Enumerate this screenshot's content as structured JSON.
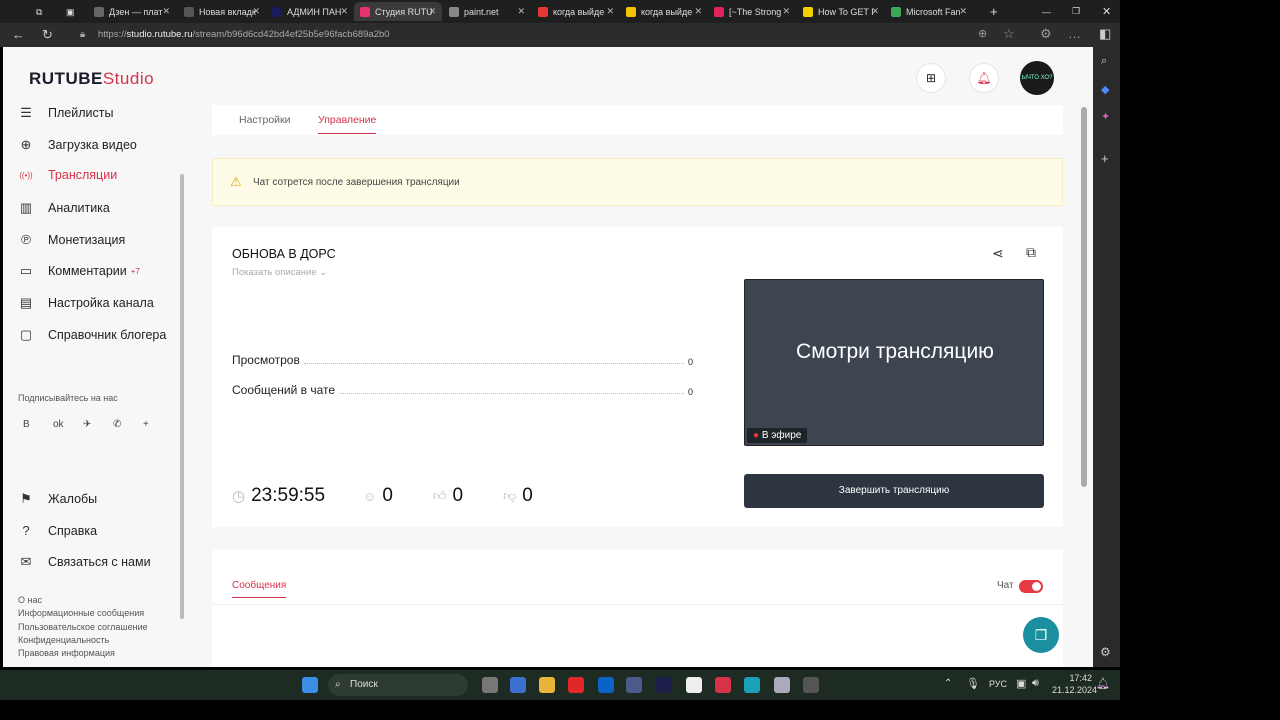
{
  "browser": {
    "tabs": [
      {
        "label": "Дзен — плат",
        "color": "#666"
      },
      {
        "label": "Новая вкладк",
        "color": "#555"
      },
      {
        "label": "АДМИН ПАН",
        "color": "#1a1a5e"
      },
      {
        "label": "Студия RUTU",
        "color": "#e5336b",
        "active": true
      },
      {
        "label": "paint.net",
        "color": "#888"
      },
      {
        "label": "когда выйде",
        "color": "#e53935"
      },
      {
        "label": "когда выйде",
        "color": "#f5c400"
      },
      {
        "label": "[~The Strong",
        "color": "#e0245e"
      },
      {
        "label": "How To GET I",
        "color": "#f5d000"
      },
      {
        "label": "Microsoft Fan",
        "color": "#3aa757"
      }
    ],
    "url_prefix": "https://",
    "url_host": "studio.rutube.ru",
    "url_path": "/stream/b96d6cd42bd4ef25b5e96facb689a2b0"
  },
  "header": {
    "logo_main": "RUTUBE",
    "logo_studio": "Studio",
    "avatar_text": "ЫЧТО ХО?"
  },
  "sidebar": {
    "items": [
      {
        "label": "Плейлисты",
        "icon": "☰"
      },
      {
        "label": "Загрузка видео",
        "icon": "⊕"
      },
      {
        "label": "Трансляции",
        "icon": "((•))"
      },
      {
        "label": "Аналитика",
        "icon": "▥"
      },
      {
        "label": "Монетизация",
        "icon": "℗"
      },
      {
        "label": "Комментарии",
        "icon": "▭",
        "badge": "+7"
      },
      {
        "label": "Настройка канала",
        "icon": "▤"
      },
      {
        "label": "Справочник блогера",
        "icon": "▢"
      }
    ],
    "follow_label": "Подписывайтесь на нас",
    "socials": [
      "vk",
      "ok",
      "tg",
      "viber",
      "+"
    ],
    "bottom_items": [
      {
        "label": "Жалобы",
        "icon": "⚑"
      },
      {
        "label": "Справка",
        "icon": "?"
      },
      {
        "label": "Связаться с нами",
        "icon": "✉"
      }
    ],
    "footer_links": [
      "О нас",
      "Информационные сообщения",
      "Пользовательское соглашение",
      "Конфиденциальность",
      "Правовая информация"
    ]
  },
  "main": {
    "tabs": [
      {
        "label": "Настройки"
      },
      {
        "label": "Управление",
        "active": true
      }
    ],
    "warning": "Чат сотрется после завершения трансляции",
    "stream": {
      "title": "ОБНОВА В ДОРС",
      "show_description": "Показать описание",
      "stats": [
        {
          "label": "Просмотров",
          "value": "0"
        },
        {
          "label": "Сообщений в чате",
          "value": "0"
        }
      ],
      "timer": "23:59:55",
      "viewers": "0",
      "likes": "0",
      "dislikes": "0",
      "preview_text": "Смотри трансляцию",
      "live_badge": "В эфире",
      "end_button": "Завершить трансляцию"
    },
    "messages_tab": "Сообщения",
    "chat_label": "Чат",
    "chat_enabled": true
  },
  "taskbar": {
    "search": "Поиск",
    "lang": "РУС",
    "time": "17:42",
    "date": "21.12.2024"
  },
  "colors": {
    "accent": "#d6334a",
    "dark_button": "#2d3540"
  }
}
